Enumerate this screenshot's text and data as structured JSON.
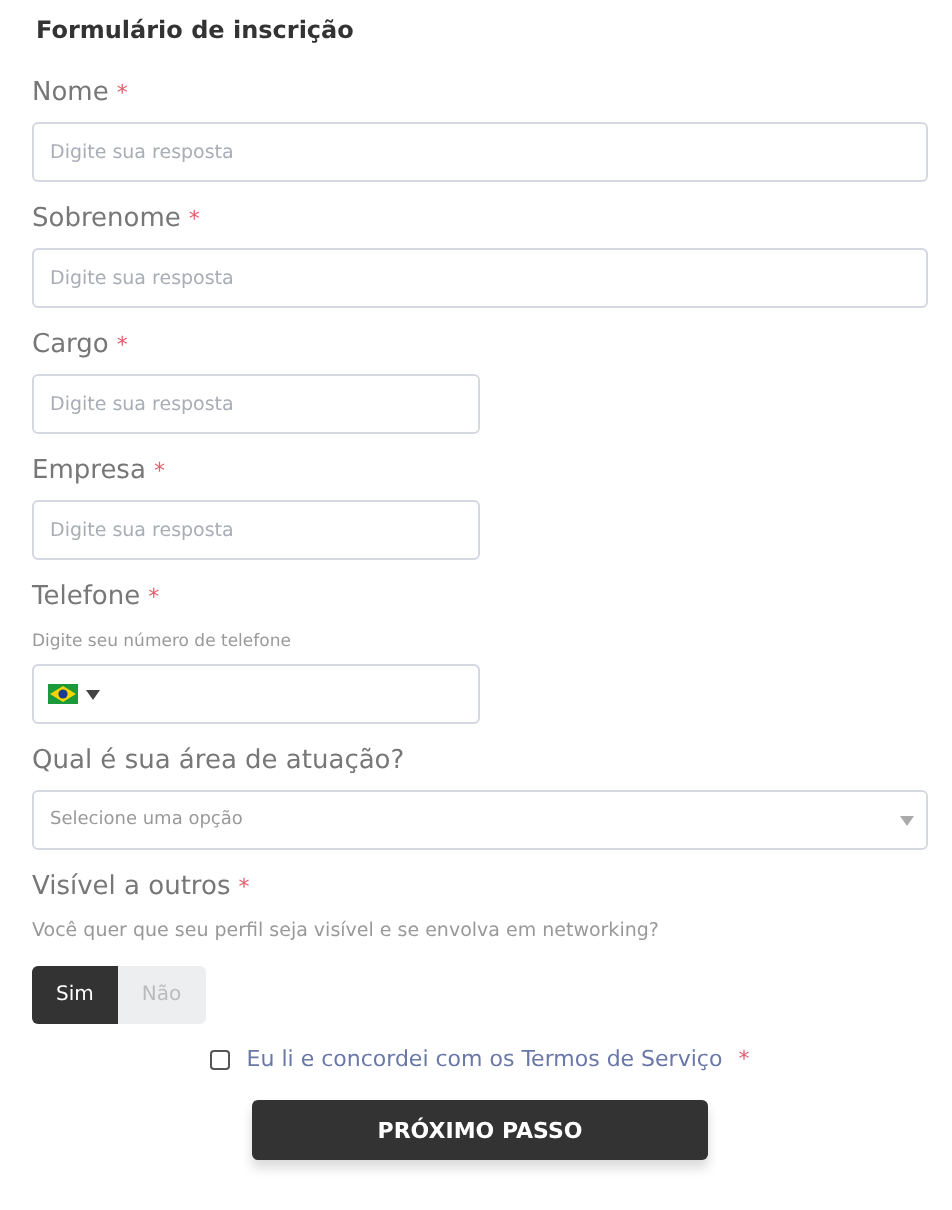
{
  "title": "Formulário de inscrição",
  "fields": [
    {
      "kind": "text",
      "label": "Nome",
      "asterisk": "*",
      "placeholder": "Digite sua resposta"
    },
    {
      "kind": "text",
      "label": "Sobrenome",
      "asterisk": "*",
      "placeholder": "Digite sua resposta"
    },
    {
      "kind": "text",
      "label": "Cargo",
      "asterisk": "*",
      "placeholder": "Digite sua resposta"
    },
    {
      "kind": "text",
      "label": "Empresa",
      "asterisk": "*",
      "placeholder": "Digite sua resposta"
    },
    {
      "kind": "phone",
      "label": "Telefone",
      "asterisk": "*",
      "hint": "Digite seu número de telefone"
    },
    {
      "kind": "select",
      "label": "Qual é sua área de atuação?",
      "placeholder": "Selecione uma opção"
    },
    {
      "kind": "toggle",
      "label": "Visível a outros",
      "asterisk": "*",
      "hint": "Você quer que seu perfil seja visível e se envolva em networking?",
      "options": [
        {
          "label": "Sim",
          "selected": true
        },
        {
          "label": "Não",
          "selected": false
        }
      ]
    }
  ],
  "terms": {
    "label": "Eu li e concordei com os Termos de Serviço",
    "asterisk": "*",
    "checked": false
  },
  "submit": "PRÓXIMO PASSO"
}
